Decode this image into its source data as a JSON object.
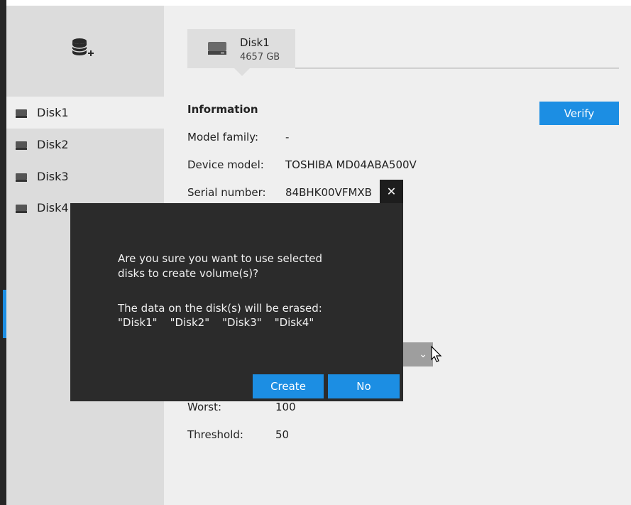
{
  "colors": {
    "accent": "#1c8ee3",
    "sidebar_bg": "#dcdcdc",
    "main_bg": "#efefef",
    "modal_bg": "#2b2b2b"
  },
  "sidebar": {
    "add_icon": "add-disk-icon",
    "items": [
      {
        "label": "Disk1",
        "icon": "hard-disk-icon",
        "active": true
      },
      {
        "label": "Disk2",
        "icon": "hard-disk-icon"
      },
      {
        "label": "Disk3",
        "icon": "hard-disk-icon"
      },
      {
        "label": "Disk4",
        "icon": "hard-disk-icon"
      }
    ]
  },
  "tab": {
    "title": "Disk1",
    "size": "4657 GB",
    "icon": "hard-disk-icon"
  },
  "info": {
    "title": "Information",
    "verify_label": "Verify",
    "rows": [
      {
        "label": "Model family:",
        "value": "-"
      },
      {
        "label": "Device model:",
        "value": "TOSHIBA MD04ABA500V"
      },
      {
        "label": "Serial number:",
        "value": "84BHK00VFMXB"
      },
      {
        "label": "Worst:",
        "value": "100"
      },
      {
        "label": "Threshold:",
        "value": "50"
      }
    ]
  },
  "close_symbol": "✕",
  "dropdown_symbol": "⌄",
  "modal": {
    "question": "Are you sure you want to use selected\ndisks to create volume(s)?",
    "warning": "The data on the disk(s) will be erased:",
    "disks": [
      "\"Disk1\"",
      "\"Disk2\"",
      "\"Disk3\"",
      "\"Disk4\""
    ],
    "create_label": "Create",
    "no_label": "No"
  }
}
